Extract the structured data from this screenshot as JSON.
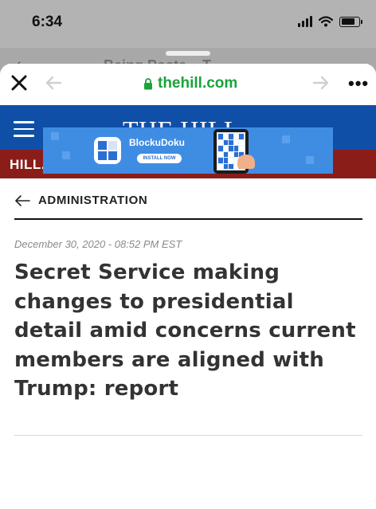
{
  "status_bar": {
    "time": "6:34",
    "battery_level": 0.8
  },
  "background_sheet": {
    "title": "Being Poste... T"
  },
  "browser": {
    "url": "thehill.com",
    "icons": {
      "close": "close-icon",
      "back": "arrow-left-icon",
      "forward": "arrow-right-icon",
      "lock": "lock-icon",
      "more": "more-horizontal-icon"
    }
  },
  "site": {
    "logo": "THE HILL",
    "subnav": "HILL.TV"
  },
  "ad": {
    "app_name": "BlockuDoku",
    "button_label": "INSTALL NOW"
  },
  "article": {
    "section": "ADMINISTRATION",
    "dateline": "December 30, 2020 - 08:52 PM EST",
    "headline": "Secret Service making changes to presidential detail amid concerns current members are aligned with Trump: report"
  },
  "colors": {
    "masthead": "#0f4fa8",
    "subnav": "#8b1d19",
    "url_green": "#1aa33b"
  }
}
